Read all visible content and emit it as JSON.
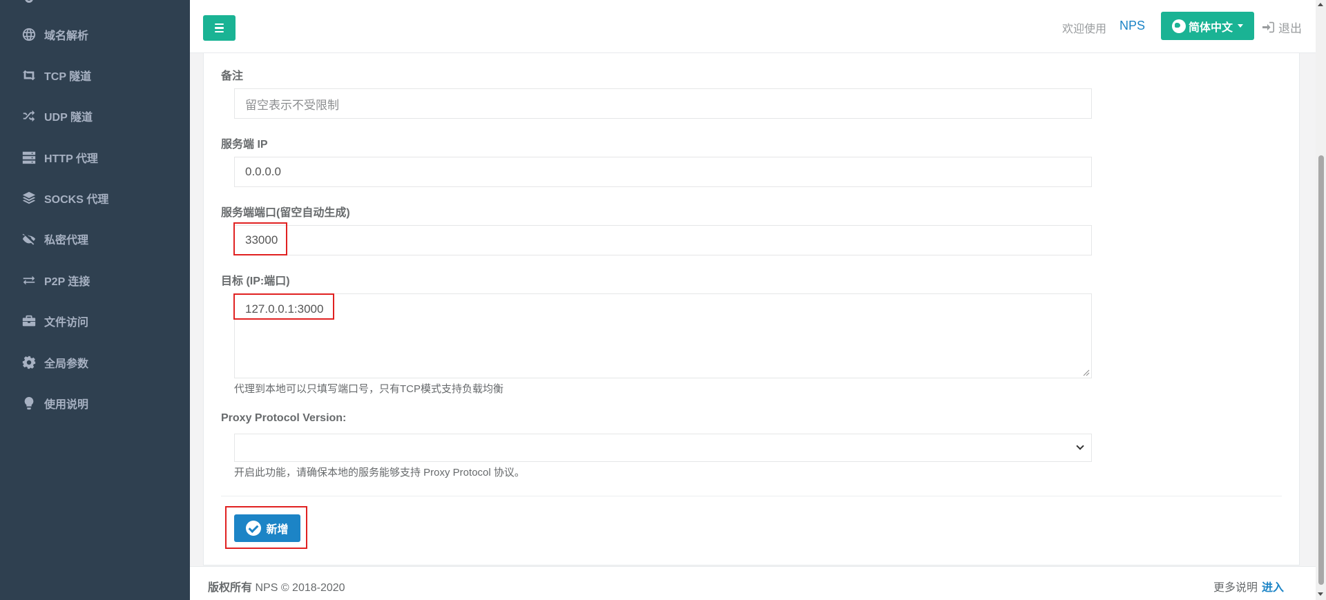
{
  "sidebar": {
    "items": [
      {
        "label": "域名解析",
        "icon": "globe-icon"
      },
      {
        "label": "TCP 隧道",
        "icon": "retweet-icon"
      },
      {
        "label": "UDP 隧道",
        "icon": "random-icon"
      },
      {
        "label": "HTTP 代理",
        "icon": "server-icon"
      },
      {
        "label": "SOCKS 代理",
        "icon": "layers-icon"
      },
      {
        "label": "私密代理",
        "icon": "eye-slash-icon"
      },
      {
        "label": "P2P 连接",
        "icon": "exchange-icon"
      },
      {
        "label": "文件访问",
        "icon": "briefcase-icon"
      },
      {
        "label": "全局参数",
        "icon": "gear-icon"
      },
      {
        "label": "使用说明",
        "icon": "lightbulb-icon"
      }
    ]
  },
  "header": {
    "welcome": "欢迎使用",
    "brand": "NPS",
    "language": "简体中文",
    "logout": "退出"
  },
  "form": {
    "remark": {
      "label": "备注",
      "placeholder": "留空表示不受限制"
    },
    "server_ip": {
      "label": "服务端 IP",
      "value": "0.0.0.0"
    },
    "server_port": {
      "label": "服务端端口(留空自动生成)",
      "value": "33000"
    },
    "target": {
      "label": "目标 (IP:端口)",
      "value": "127.0.0.1:3000",
      "help": "代理到本地可以只填写端口号，只有TCP模式支持负载均衡"
    },
    "proxy_protocol": {
      "label": "Proxy Protocol Version:",
      "value": "",
      "help": "开启此功能，请确保本地的服务能够支持 Proxy Protocol 协议。"
    },
    "submit": "新增"
  },
  "footer": {
    "copyright_bold": "版权所有",
    "copyright_rest": "NPS © 2018-2020",
    "more": "更多说明",
    "enter": "进入"
  },
  "colors": {
    "sidebar_bg": "#2f4050",
    "primary": "#1ab394",
    "link": "#1c84c6",
    "highlight": "#e02020"
  }
}
